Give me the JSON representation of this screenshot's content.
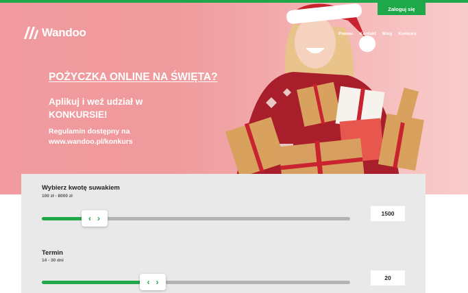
{
  "brand": {
    "name": "Wandoo",
    "accent": "#1ea84a"
  },
  "header": {
    "login_label": "Zaloguj się",
    "nav": [
      "Pomoc",
      "Kontakt",
      "Blog",
      "Konkurs"
    ]
  },
  "hero": {
    "headline": "POŻYCZKA ONLINE NA ŚWIĘTA?",
    "subtitle": "Aplikuj i weź udział w KONKURSIE!",
    "rules": "Regulamin dostępny na www.wandoo.pl/konkurs"
  },
  "calculator": {
    "amount": {
      "title": "Wybierz kwotę suwakiem",
      "range": "100 zł - 8000 zł",
      "value": "1500",
      "fill_fraction": 0.17
    },
    "term": {
      "title": "Termin",
      "range": "14 - 30 dni",
      "value": "20",
      "fill_fraction": 0.36
    },
    "knob_left": "‹",
    "knob_right": "›"
  }
}
